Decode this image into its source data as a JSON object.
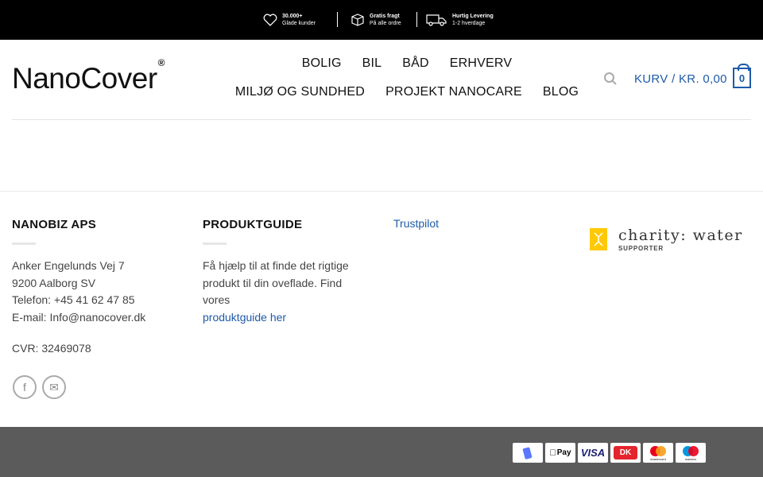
{
  "topbar": {
    "usps": [
      {
        "icon": "heart-icon",
        "line1": "30.000+",
        "line2": "Glade kunder"
      },
      {
        "icon": "box-icon",
        "line1": "Gratis fragt",
        "line2": "På alle ordre"
      },
      {
        "icon": "truck-icon",
        "line1": "Hurtig Levering",
        "line2": "1-2 hverdage"
      }
    ]
  },
  "header": {
    "logo": "NanoCover",
    "logo_mark": "®",
    "nav": [
      "BOLIG",
      "BIL",
      "BÅD",
      "ERHVERV",
      "MILJØ OG SUNDHED",
      "PROJEKT NANOCARE",
      "BLOG"
    ],
    "cart_label": "KURV / KR. 0,00",
    "cart_count": "0"
  },
  "footer": {
    "company": {
      "title": "NANOBIZ APS",
      "address1": "Anker Engelunds Vej 7",
      "address2": "9200 Aalborg SV",
      "phone": "Telefon: +45 41 62 47 85",
      "email": "E-mail: Info@nanocover.dk",
      "cvr": "CVR: 32469078"
    },
    "guide": {
      "title": "PRODUKTGUIDE",
      "text": "Få hjælp til at finde det rigtige produkt til din oveflade. Find vores",
      "link": "produktguide her"
    },
    "trustpilot": "Trustpilot",
    "charity": {
      "name": "charity: water",
      "sub": "SUPPORTER"
    },
    "social": [
      {
        "icon": "facebook-icon",
        "glyph": "f"
      },
      {
        "icon": "email-icon",
        "glyph": "✉"
      }
    ]
  },
  "payments": [
    "MobilePay",
    "Pay",
    "VISA",
    "DK",
    "mastercard",
    "maestro"
  ],
  "colors": {
    "accent": "#1e5ba8",
    "topbar": "#000000",
    "bottombar": "#5b5b5b",
    "charity": "#ffc907"
  }
}
